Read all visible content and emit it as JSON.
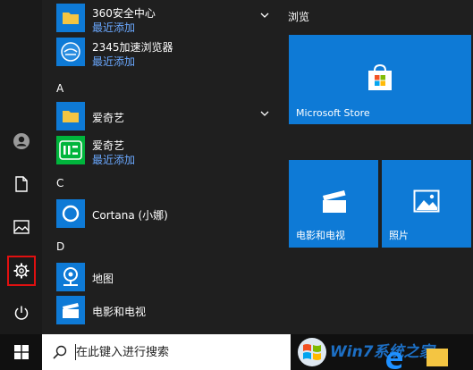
{
  "apps": [
    {
      "name": "360安全中心",
      "sub": "最近添加",
      "has_chevron": true
    },
    {
      "name": "2345加速浏览器",
      "sub": "最近添加",
      "has_chevron": false
    },
    {
      "name": "爱奇艺",
      "sub": "",
      "has_chevron": true
    },
    {
      "name": "爱奇艺",
      "sub": "最近添加",
      "has_chevron": false
    },
    {
      "name": "Cortana (小娜)",
      "sub": "",
      "has_chevron": false
    },
    {
      "name": "地图",
      "sub": "",
      "has_chevron": false
    },
    {
      "name": "电影和电视",
      "sub": "",
      "has_chevron": false
    }
  ],
  "letters": [
    "A",
    "C",
    "D"
  ],
  "tiles": {
    "group_title": "浏览",
    "store_label": "Microsoft Store",
    "movies_label": "电影和电视",
    "photos_label": "照片"
  },
  "search": {
    "placeholder": "在此键入进行搜索"
  },
  "watermark": {
    "text": "Win7系统之家"
  },
  "colors": {
    "tile": "#0e7ad6",
    "recent_text": "#6aa8ff",
    "highlight": "#e01010"
  }
}
